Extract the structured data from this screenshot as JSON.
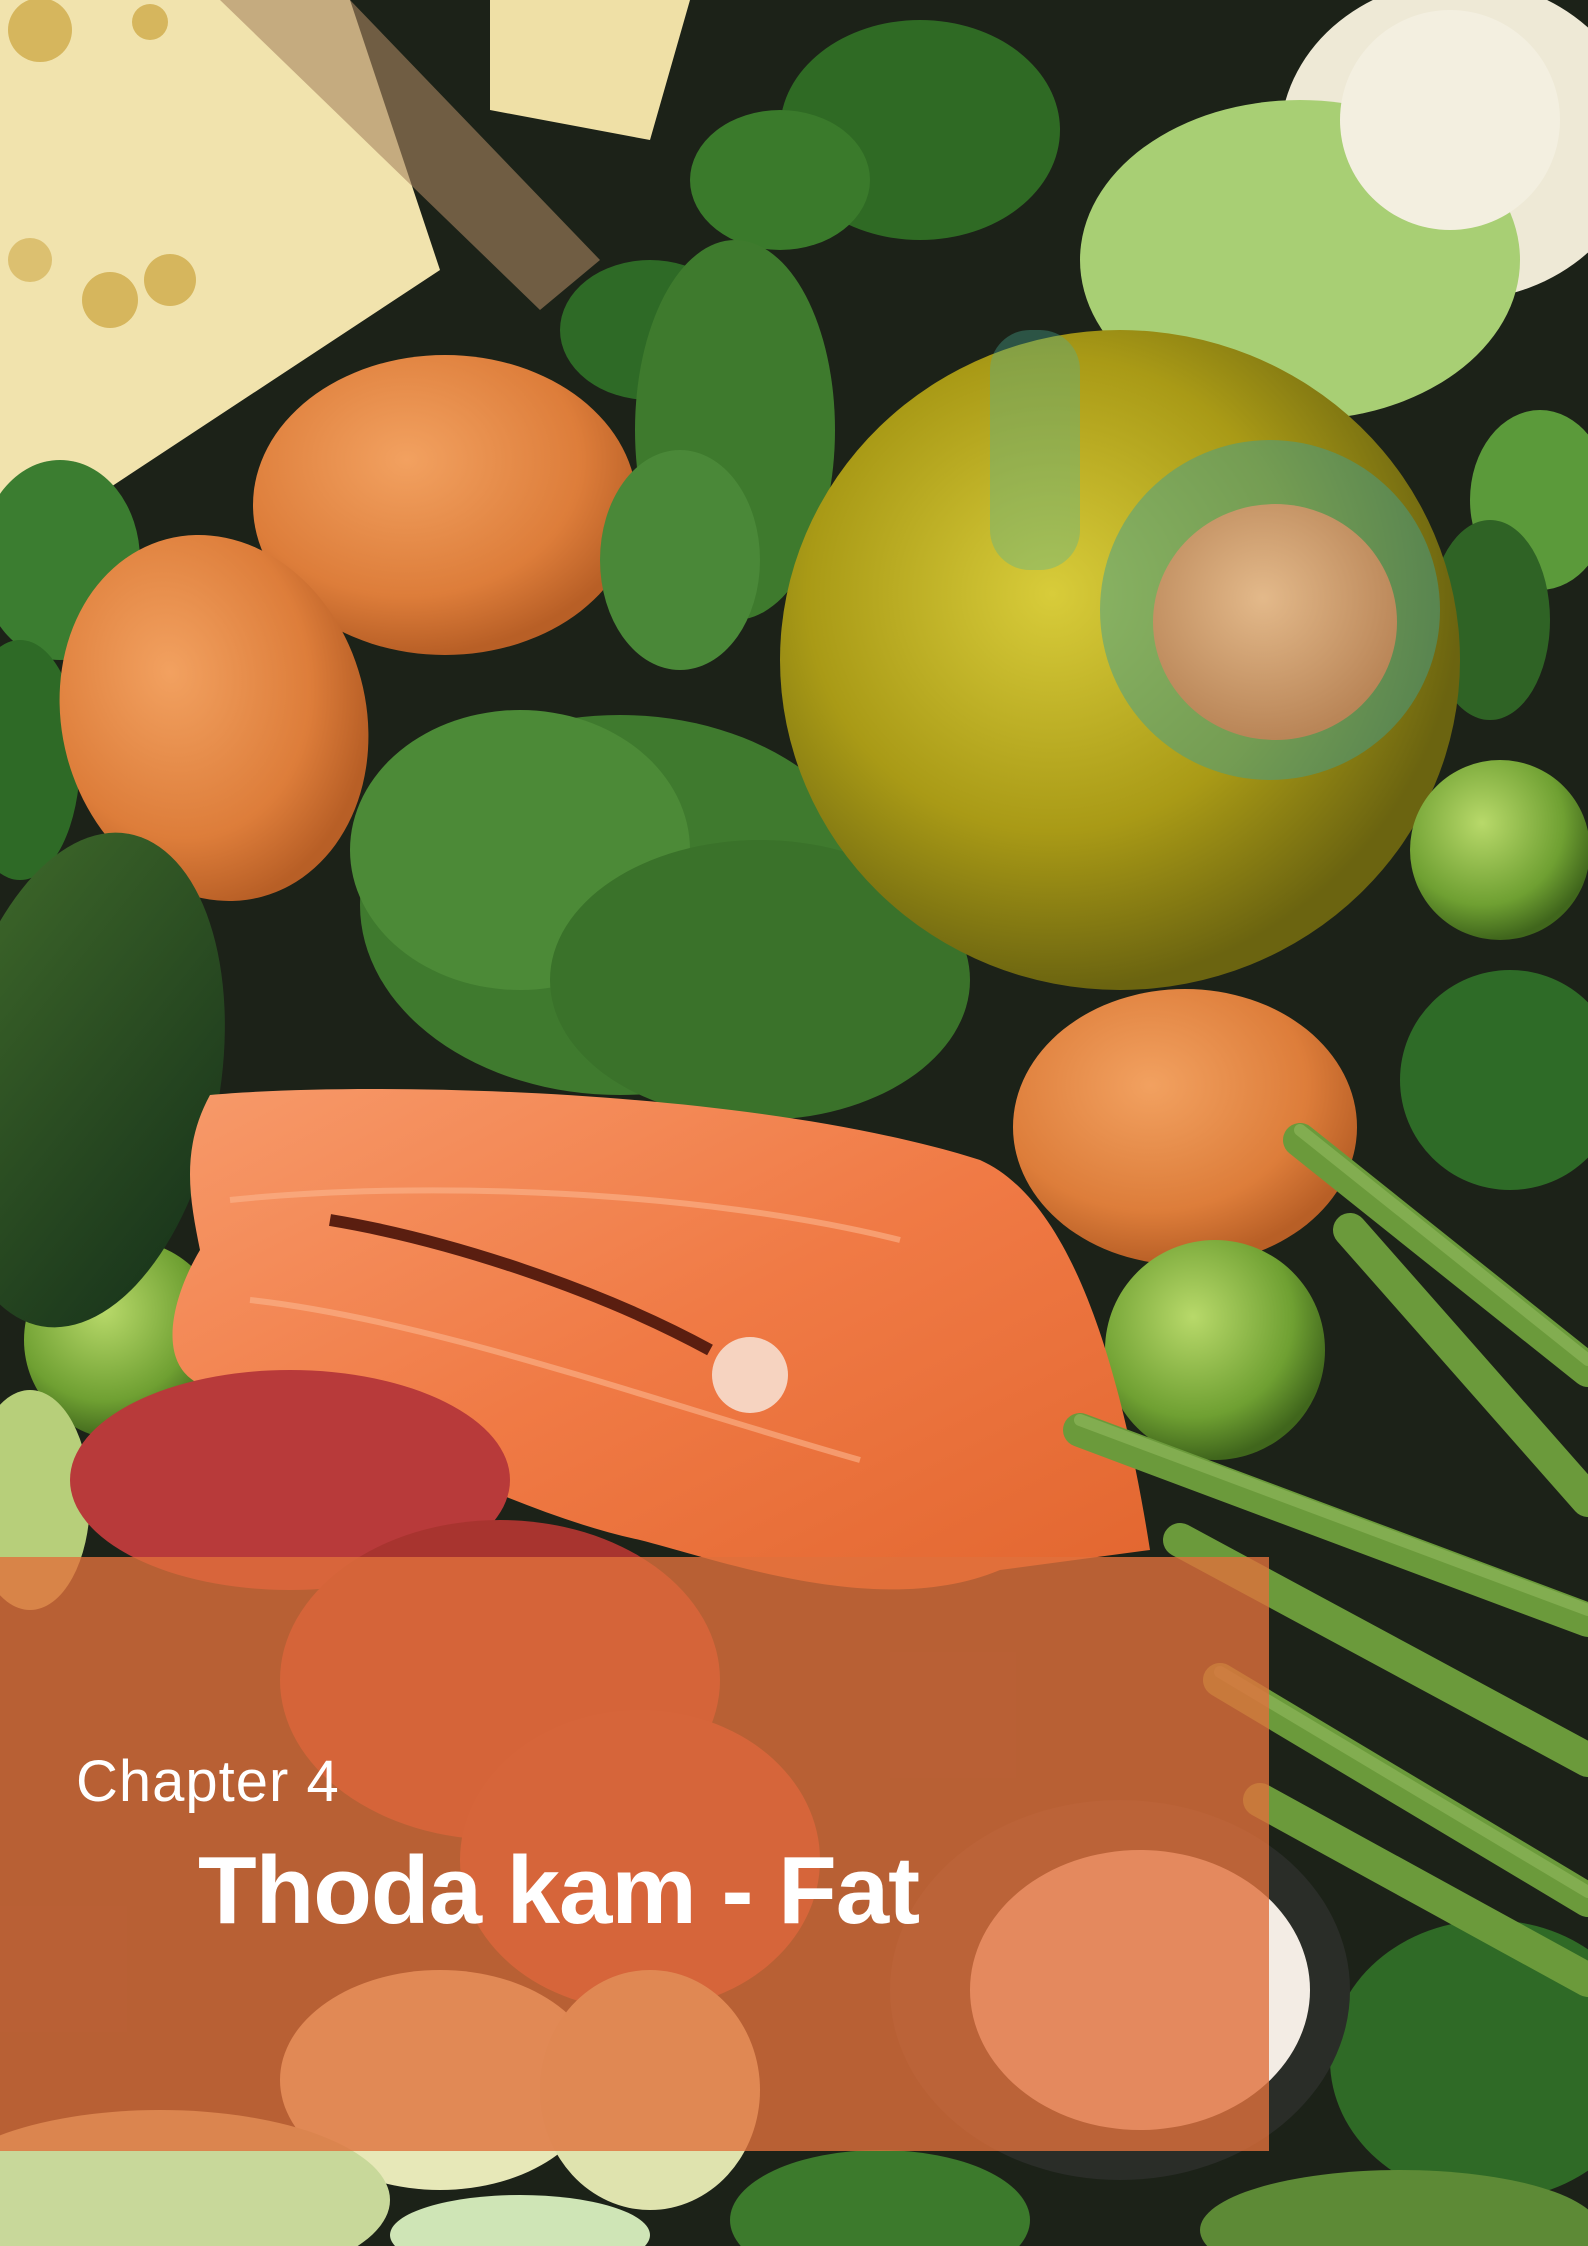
{
  "chapter": {
    "label": "Chapter 4",
    "title": "Thoda kam - Fat"
  },
  "colors": {
    "banner": "#e0703c",
    "text": "#ffffff"
  }
}
